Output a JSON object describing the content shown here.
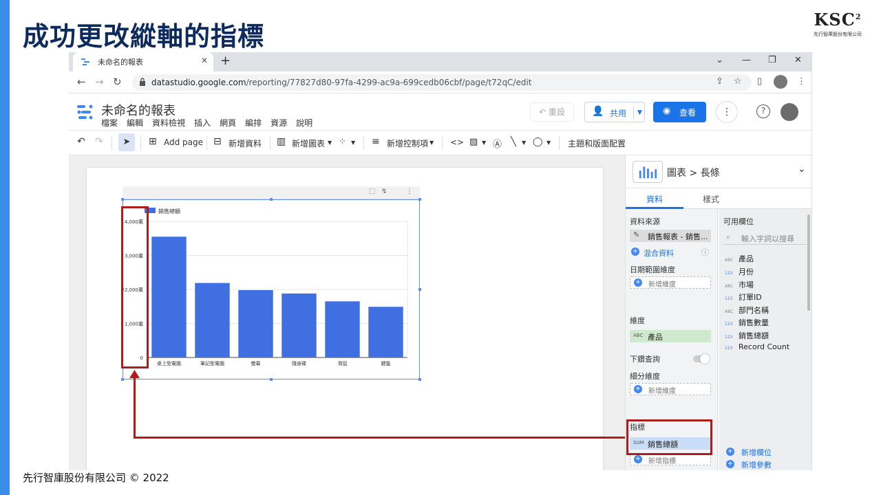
{
  "slide": {
    "title": "成功更改縱軸的指標",
    "logo_mark": "KSC",
    "logo_sup": "2",
    "logo_sub": "先行智庫股份有限公司",
    "footer": "先行智庫股份有限公司 © 2022"
  },
  "browser": {
    "tab_title": "未命名的報表",
    "url_host": "datastudio.google.com",
    "url_path": "/reporting/77827d80-97fa-4299-ac9a-699cedb06cbf/page/t72qC/edit"
  },
  "app": {
    "title": "未命名的報表",
    "menu": [
      "檔案",
      "編輯",
      "資料檢視",
      "插入",
      "網頁",
      "編排",
      "資源",
      "說明"
    ],
    "reset_label": "重設",
    "share_label": "共用",
    "view_label": "查看"
  },
  "toolbar": {
    "add_page": "Add page",
    "add_data": "新增資料",
    "add_chart": "新增圖表",
    "add_control": "新增控制項",
    "theme_layout": "主題和版面配置"
  },
  "chart_data": {
    "type": "bar",
    "categories": [
      "桌上型電腦",
      "筆記型電腦",
      "螢幕",
      "隨身碟",
      "滑鼠",
      "鍵盤"
    ],
    "series": [
      {
        "name": "銷售總額",
        "values": [
          3550,
          2190,
          1980,
          1880,
          1650,
          1490
        ]
      }
    ],
    "ylim": [
      0,
      4000
    ],
    "yticks": [
      0,
      1000,
      2000,
      3000,
      4000
    ],
    "ytick_labels": [
      "0",
      "1,000萬",
      "2,000萬",
      "3,000萬",
      "4,000萬"
    ],
    "legend": "top-left",
    "bar_color": "#3f6fe0",
    "grid": true
  },
  "panel": {
    "crumb_chart": "圖表",
    "crumb_sep": ">",
    "crumb_type": "長條",
    "tab_data": "資料",
    "tab_style": "樣式",
    "data_source_label": "資料來源",
    "data_source_value": "銷售報表 - 銷售...",
    "blend_data": "混合資料",
    "date_range_label": "日期範圍維度",
    "add_dimension": "新增維度",
    "dimension_label": "維度",
    "dimension_value": "產品",
    "drilldown_label": "下鑽查詢",
    "breakdown_label": "細分維度",
    "metric_label": "指標",
    "metric_value": "銷售總額",
    "metric_tag": "SUM",
    "add_metric": "新增指標",
    "available_fields_label": "可用欄位",
    "search_placeholder": "輸入字詞以搜尋",
    "fields": [
      {
        "tag": "ABC",
        "name": "產品"
      },
      {
        "tag": "123",
        "name": "月份"
      },
      {
        "tag": "ABC",
        "name": "市場"
      },
      {
        "tag": "123",
        "name": "訂單ID"
      },
      {
        "tag": "ABC",
        "name": "部門名稱"
      },
      {
        "tag": "123",
        "name": "銷售數量"
      },
      {
        "tag": "123",
        "name": "銷售總額"
      },
      {
        "tag": "123",
        "name": "Record Count"
      }
    ],
    "add_field": "新增欄位",
    "add_param": "新增參數"
  }
}
